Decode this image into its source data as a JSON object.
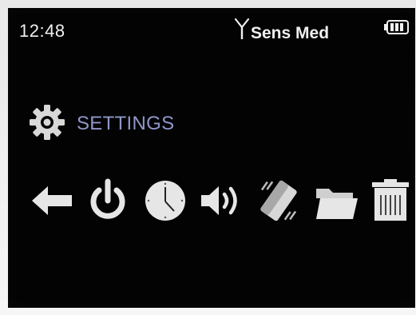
{
  "status_bar": {
    "time": "12:48",
    "operator": "Sens Med",
    "signal_icon": "antenna-icon",
    "battery_icon": "battery-icon"
  },
  "screen": {
    "title": "SETTINGS",
    "title_icon": "gear-icon",
    "title_color": "#8f97c9"
  },
  "menu": {
    "items": [
      {
        "icon": "back-arrow-icon"
      },
      {
        "icon": "power-icon"
      },
      {
        "icon": "clock-icon"
      },
      {
        "icon": "speaker-icon"
      },
      {
        "icon": "vibrate-icon"
      },
      {
        "icon": "folder-icon"
      },
      {
        "icon": "trash-icon"
      }
    ]
  },
  "colors": {
    "screen_bg": "#030303",
    "text": "#f0f0f0",
    "icon": "#e6e6e6",
    "accent": "#8f97c9"
  }
}
